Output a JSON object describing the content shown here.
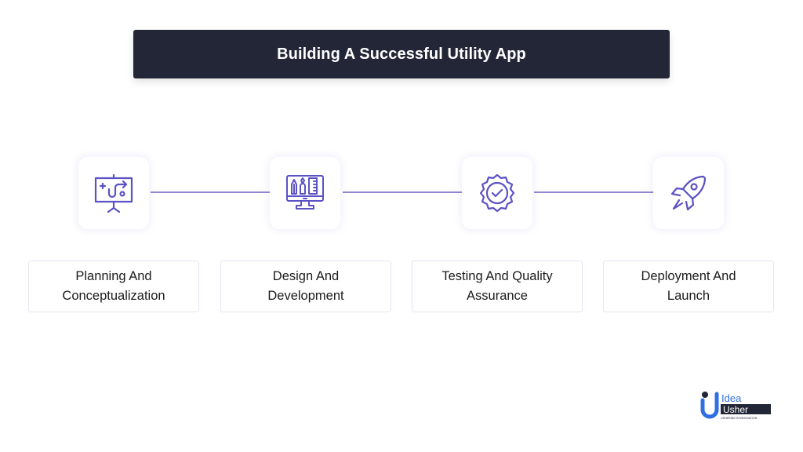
{
  "title": "Building A Successful Utility App",
  "accent_color": "#5b52c4",
  "steps": [
    {
      "label": "Planning And\nConceptualization",
      "icon": "presentation-board-icon"
    },
    {
      "label": "Design And\nDevelopment",
      "icon": "monitor-design-tools-icon"
    },
    {
      "label": "Testing And Quality\nAssurance",
      "icon": "quality-badge-check-icon"
    },
    {
      "label": "Deployment And\nLaunch",
      "icon": "rocket-icon"
    }
  ],
  "logo": {
    "line1": "Idea",
    "line2": "Usher",
    "tagline": "USHERING IN INNOVATION"
  }
}
